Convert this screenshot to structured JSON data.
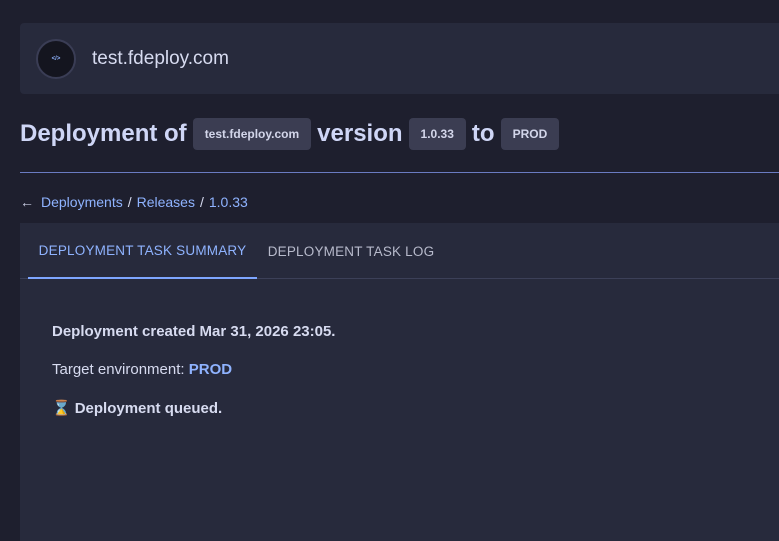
{
  "header": {
    "logo_icon": "fdeploy-logo-icon",
    "site_name": "test.fdeploy.com"
  },
  "heading": {
    "prefix": "Deployment of",
    "site_chip": "test.fdeploy.com",
    "version_word": "version",
    "version_chip": "1.0.33",
    "to_word": "to",
    "env_chip": "PROD"
  },
  "breadcrumb": {
    "back_icon": "arrow-left-icon",
    "items": [
      "Deployments",
      "Releases",
      "1.0.33"
    ],
    "separator": "/"
  },
  "tabs": [
    {
      "label": "DEPLOYMENT TASK SUMMARY",
      "active": true
    },
    {
      "label": "DEPLOYMENT TASK LOG",
      "active": false
    }
  ],
  "summary": {
    "created": "Deployment created Mar 31, 2026 23:05.",
    "target_label": "Target environment:",
    "target_value": "PROD",
    "status_icon": "hourglass-icon",
    "status": "Deployment queued."
  },
  "colors": {
    "accent": "#8fb3ff",
    "background": "#1e1f2e",
    "card": "#272a3c"
  }
}
